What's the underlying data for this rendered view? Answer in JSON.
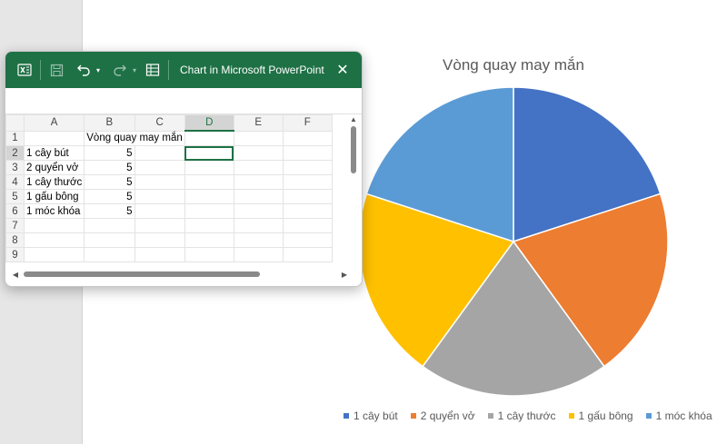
{
  "excel": {
    "title": "Chart in Microsoft PowerPoint",
    "icons": {
      "app": "excel-icon",
      "save": "save-icon",
      "undo": "undo-icon",
      "redo": "redo-icon",
      "edit_data": "edit-data-icon",
      "close": "close-icon"
    },
    "columns": [
      "A",
      "B",
      "C",
      "D",
      "E",
      "F"
    ],
    "rows": [
      "1",
      "2",
      "3",
      "4",
      "5",
      "6",
      "7",
      "8",
      "9"
    ],
    "header_cell": "Vòng quay may mắn",
    "items": [
      {
        "label": "1 cây bút",
        "value": "5"
      },
      {
        "label": "2 quyển vở",
        "value": "5"
      },
      {
        "label": "1 cây thước",
        "value": "5"
      },
      {
        "label": "1 gấu bông",
        "value": "5"
      },
      {
        "label": "1 móc khóa",
        "value": "5"
      }
    ],
    "selected_cell": "D2"
  },
  "chart_data": {
    "type": "pie",
    "title": "Vòng quay may mắn",
    "categories": [
      "1 cây bút",
      "2 quyển vở",
      "1 cây thước",
      "1 gấu bông",
      "1 móc khóa"
    ],
    "values": [
      5,
      5,
      5,
      5,
      5
    ],
    "colors": [
      "#4472c4",
      "#ed7d31",
      "#a5a5a5",
      "#ffc000",
      "#5b9bd5"
    ],
    "legend_position": "bottom"
  }
}
